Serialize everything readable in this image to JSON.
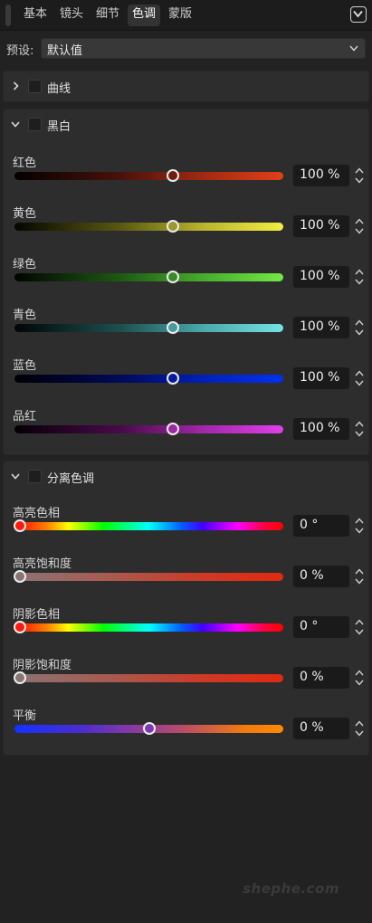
{
  "tabs": [
    {
      "label": "基本"
    },
    {
      "label": "镜头"
    },
    {
      "label": "细节"
    },
    {
      "label": "色调"
    },
    {
      "label": "蒙版"
    }
  ],
  "active_tab": "色调",
  "preset": {
    "label": "预设:",
    "value": "默认值"
  },
  "curves": {
    "title": "曲线",
    "checked": false,
    "expanded": false
  },
  "bw": {
    "title": "黑白",
    "checked": false,
    "expanded": true,
    "rows": [
      {
        "label": "红色",
        "value": "100 %"
      },
      {
        "label": "黄色",
        "value": "100 %"
      },
      {
        "label": "绿色",
        "value": "100 %"
      },
      {
        "label": "青色",
        "value": "100 %"
      },
      {
        "label": "蓝色",
        "value": "100 %"
      },
      {
        "label": "品红",
        "value": "100 %"
      }
    ]
  },
  "split": {
    "title": "分离色调",
    "checked": false,
    "expanded": true,
    "rows": [
      {
        "label": "高亮色相",
        "value": "0 °"
      },
      {
        "label": "高亮饱和度",
        "value": "0 %"
      },
      {
        "label": "阴影色相",
        "value": "0 °"
      },
      {
        "label": "阴影饱和度",
        "value": "0 %"
      },
      {
        "label": "平衡",
        "value": "0 %"
      }
    ]
  },
  "colors": {
    "background": "#222222",
    "panel": "#2d2d2d",
    "value_box": "#1a1a1a"
  },
  "watermark": "shephe.com"
}
